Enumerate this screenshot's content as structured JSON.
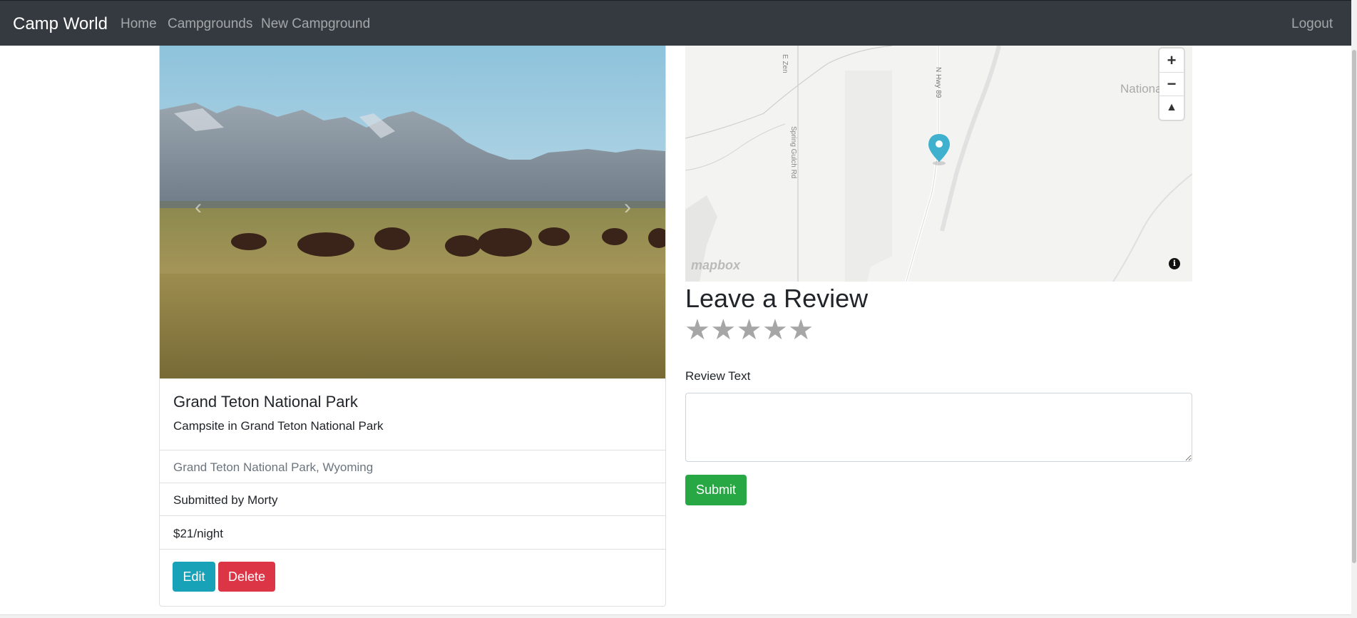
{
  "navbar": {
    "brand": "Camp World",
    "links": [
      "Home",
      "Campgrounds",
      "New Campground"
    ],
    "logout": "Logout",
    "bg_color": "#343a40"
  },
  "campground": {
    "title": "Grand Teton National Park",
    "description": "Campsite in Grand Teton National Park",
    "location": "Grand Teton National Park, Wyoming",
    "author": "Submitted by Morty",
    "price": "$21/night",
    "carousel_prev_icon": "chevron-left-icon",
    "carousel_next_icon": "chevron-right-icon"
  },
  "actions": {
    "edit_label": "Edit",
    "delete_label": "Delete",
    "edit_color": "#17a2b8",
    "delete_color": "#dc3545"
  },
  "map": {
    "zoom_in": "+",
    "zoom_out": "−",
    "compass_icon": "compass-icon",
    "attribution": "mapbox",
    "info_icon": "info-icon",
    "labels": [
      "N Hwy 89",
      "Spring Gulch Rd",
      "E Zen",
      "National"
    ],
    "marker_color": "#3fb1ce"
  },
  "review": {
    "heading": "Leave a Review",
    "rating": 0,
    "max_rating": 5,
    "text_label": "Review Text",
    "text_value": "",
    "submit_label": "Submit",
    "submit_color": "#28a745"
  }
}
